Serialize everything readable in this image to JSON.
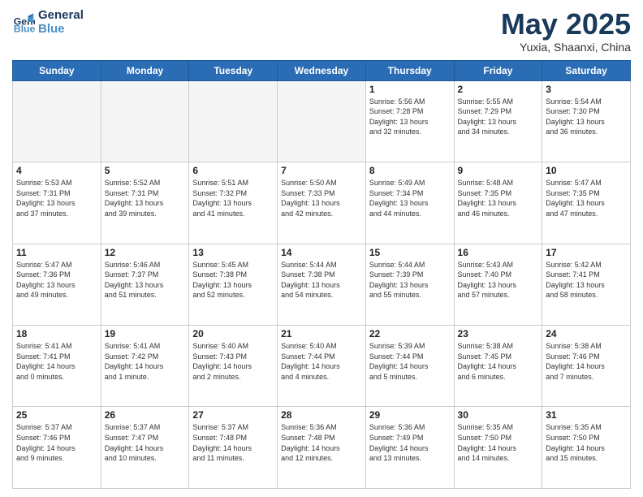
{
  "logo": {
    "line1": "General",
    "line2": "Blue"
  },
  "title": "May 2025",
  "subtitle": "Yuxia, Shaanxi, China",
  "weekdays": [
    "Sunday",
    "Monday",
    "Tuesday",
    "Wednesday",
    "Thursday",
    "Friday",
    "Saturday"
  ],
  "weeks": [
    [
      {
        "day": "",
        "content": ""
      },
      {
        "day": "",
        "content": ""
      },
      {
        "day": "",
        "content": ""
      },
      {
        "day": "",
        "content": ""
      },
      {
        "day": "1",
        "content": "Sunrise: 5:56 AM\nSunset: 7:28 PM\nDaylight: 13 hours\nand 32 minutes."
      },
      {
        "day": "2",
        "content": "Sunrise: 5:55 AM\nSunset: 7:29 PM\nDaylight: 13 hours\nand 34 minutes."
      },
      {
        "day": "3",
        "content": "Sunrise: 5:54 AM\nSunset: 7:30 PM\nDaylight: 13 hours\nand 36 minutes."
      }
    ],
    [
      {
        "day": "4",
        "content": "Sunrise: 5:53 AM\nSunset: 7:31 PM\nDaylight: 13 hours\nand 37 minutes."
      },
      {
        "day": "5",
        "content": "Sunrise: 5:52 AM\nSunset: 7:31 PM\nDaylight: 13 hours\nand 39 minutes."
      },
      {
        "day": "6",
        "content": "Sunrise: 5:51 AM\nSunset: 7:32 PM\nDaylight: 13 hours\nand 41 minutes."
      },
      {
        "day": "7",
        "content": "Sunrise: 5:50 AM\nSunset: 7:33 PM\nDaylight: 13 hours\nand 42 minutes."
      },
      {
        "day": "8",
        "content": "Sunrise: 5:49 AM\nSunset: 7:34 PM\nDaylight: 13 hours\nand 44 minutes."
      },
      {
        "day": "9",
        "content": "Sunrise: 5:48 AM\nSunset: 7:35 PM\nDaylight: 13 hours\nand 46 minutes."
      },
      {
        "day": "10",
        "content": "Sunrise: 5:47 AM\nSunset: 7:35 PM\nDaylight: 13 hours\nand 47 minutes."
      }
    ],
    [
      {
        "day": "11",
        "content": "Sunrise: 5:47 AM\nSunset: 7:36 PM\nDaylight: 13 hours\nand 49 minutes."
      },
      {
        "day": "12",
        "content": "Sunrise: 5:46 AM\nSunset: 7:37 PM\nDaylight: 13 hours\nand 51 minutes."
      },
      {
        "day": "13",
        "content": "Sunrise: 5:45 AM\nSunset: 7:38 PM\nDaylight: 13 hours\nand 52 minutes."
      },
      {
        "day": "14",
        "content": "Sunrise: 5:44 AM\nSunset: 7:38 PM\nDaylight: 13 hours\nand 54 minutes."
      },
      {
        "day": "15",
        "content": "Sunrise: 5:44 AM\nSunset: 7:39 PM\nDaylight: 13 hours\nand 55 minutes."
      },
      {
        "day": "16",
        "content": "Sunrise: 5:43 AM\nSunset: 7:40 PM\nDaylight: 13 hours\nand 57 minutes."
      },
      {
        "day": "17",
        "content": "Sunrise: 5:42 AM\nSunset: 7:41 PM\nDaylight: 13 hours\nand 58 minutes."
      }
    ],
    [
      {
        "day": "18",
        "content": "Sunrise: 5:41 AM\nSunset: 7:41 PM\nDaylight: 14 hours\nand 0 minutes."
      },
      {
        "day": "19",
        "content": "Sunrise: 5:41 AM\nSunset: 7:42 PM\nDaylight: 14 hours\nand 1 minute."
      },
      {
        "day": "20",
        "content": "Sunrise: 5:40 AM\nSunset: 7:43 PM\nDaylight: 14 hours\nand 2 minutes."
      },
      {
        "day": "21",
        "content": "Sunrise: 5:40 AM\nSunset: 7:44 PM\nDaylight: 14 hours\nand 4 minutes."
      },
      {
        "day": "22",
        "content": "Sunrise: 5:39 AM\nSunset: 7:44 PM\nDaylight: 14 hours\nand 5 minutes."
      },
      {
        "day": "23",
        "content": "Sunrise: 5:38 AM\nSunset: 7:45 PM\nDaylight: 14 hours\nand 6 minutes."
      },
      {
        "day": "24",
        "content": "Sunrise: 5:38 AM\nSunset: 7:46 PM\nDaylight: 14 hours\nand 7 minutes."
      }
    ],
    [
      {
        "day": "25",
        "content": "Sunrise: 5:37 AM\nSunset: 7:46 PM\nDaylight: 14 hours\nand 9 minutes."
      },
      {
        "day": "26",
        "content": "Sunrise: 5:37 AM\nSunset: 7:47 PM\nDaylight: 14 hours\nand 10 minutes."
      },
      {
        "day": "27",
        "content": "Sunrise: 5:37 AM\nSunset: 7:48 PM\nDaylight: 14 hours\nand 11 minutes."
      },
      {
        "day": "28",
        "content": "Sunrise: 5:36 AM\nSunset: 7:48 PM\nDaylight: 14 hours\nand 12 minutes."
      },
      {
        "day": "29",
        "content": "Sunrise: 5:36 AM\nSunset: 7:49 PM\nDaylight: 14 hours\nand 13 minutes."
      },
      {
        "day": "30",
        "content": "Sunrise: 5:35 AM\nSunset: 7:50 PM\nDaylight: 14 hours\nand 14 minutes."
      },
      {
        "day": "31",
        "content": "Sunrise: 5:35 AM\nSunset: 7:50 PM\nDaylight: 14 hours\nand 15 minutes."
      }
    ]
  ]
}
